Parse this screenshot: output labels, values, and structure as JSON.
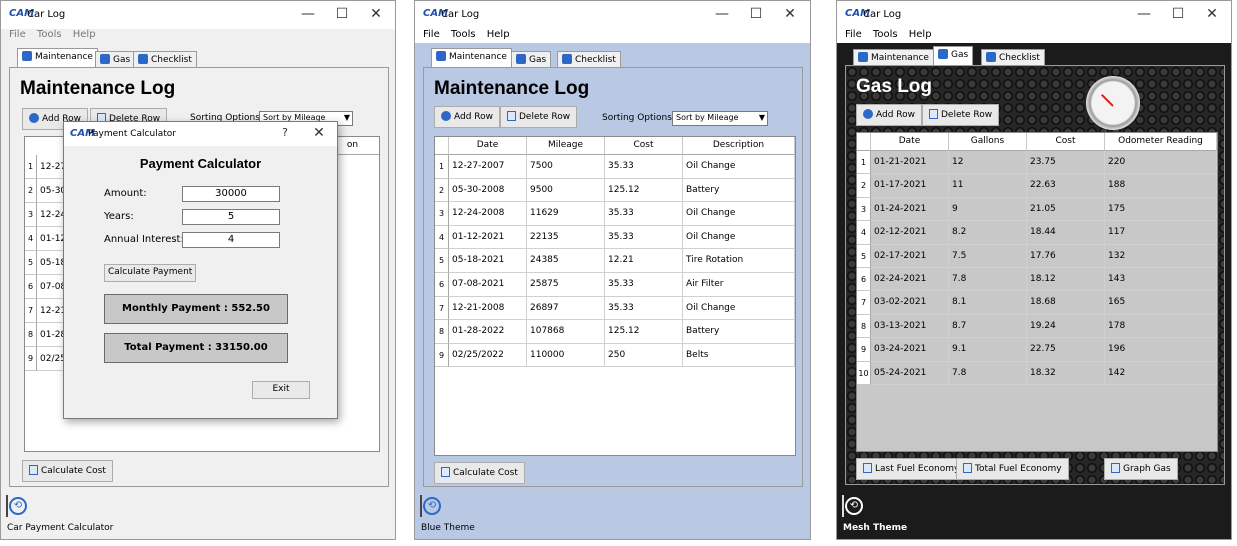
{
  "colors": {
    "accent": "#2d67c7",
    "blue_theme_bg": "#b9c9e3",
    "mesh_bg": "#1b1b1b"
  },
  "window_controls": {
    "minimize": "—",
    "maximize": "☐",
    "close": "✕"
  },
  "icons": {
    "logo": "CAM",
    "run_icon": "⟲"
  },
  "common": {
    "app_title": "Car Log",
    "menu": [
      "File",
      "Tools",
      "Help"
    ],
    "tabs": [
      "Maintenance",
      "Gas",
      "Checklist"
    ]
  },
  "maintenance": {
    "title": "Maintenance Log",
    "add_row": "Add Row",
    "delete_row": "Delete Row",
    "sort_label": "Sorting Options:",
    "sort_value": "Sort by Mileage",
    "calc_button": "Calculate Cost",
    "columns": [
      "Date",
      "Mileage",
      "Cost",
      "Description"
    ],
    "rows": [
      [
        "1",
        "12-27-2007",
        "7500",
        "35.33",
        "Oil Change"
      ],
      [
        "2",
        "05-30-2008",
        "9500",
        "125.12",
        "Battery"
      ],
      [
        "3",
        "12-24-2008",
        "11629",
        "35.33",
        "Oil Change"
      ],
      [
        "4",
        "01-12-2021",
        "22135",
        "35.33",
        "Oil Change"
      ],
      [
        "5",
        "05-18-2021",
        "24385",
        "12.21",
        "Tire Rotation"
      ],
      [
        "6",
        "07-08-2021",
        "25875",
        "35.33",
        "Air Filter"
      ],
      [
        "7",
        "12-21-2008",
        "26897",
        "35.33",
        "Oil Change"
      ],
      [
        "8",
        "01-28-2022",
        "107868",
        "125.12",
        "Battery"
      ],
      [
        "9",
        "02/25/2022",
        "110000",
        "250",
        "Belts"
      ]
    ]
  },
  "window1": {
    "status": "Car Payment Calculator",
    "partial_rows": [
      "12-27",
      "05-30-",
      "12-24-",
      "01-12-",
      "05-18-",
      "07-08-",
      "12-21-",
      "01-28-",
      "02/25/"
    ],
    "partial_header": "on",
    "dialog": {
      "title": "Payment Calculator",
      "help": "?",
      "close": "✕",
      "heading": "Payment Calculator",
      "amount_label": "Amount:",
      "amount": "30000",
      "years_label": "Years:",
      "years": "5",
      "interest_label": "Annual Interest:",
      "interest": "4",
      "calc_button": "Calculate Payment",
      "monthly": "Monthly Payment : 552.50",
      "total": "Total Payment : 33150.00",
      "exit": "Exit"
    }
  },
  "window2": {
    "status": "Blue Theme"
  },
  "window3": {
    "status": "Mesh Theme",
    "title": "Gas Log",
    "columns": [
      "Date",
      "Gallons",
      "Cost",
      "Odometer Reading"
    ],
    "rows": [
      [
        "1",
        "01-21-2021",
        "12",
        "23.75",
        "220"
      ],
      [
        "2",
        "01-17-2021",
        "11",
        "22.63",
        "188"
      ],
      [
        "3",
        "01-24-2021",
        "9",
        "21.05",
        "175"
      ],
      [
        "4",
        "02-12-2021",
        "8.2",
        "18.44",
        "117"
      ],
      [
        "5",
        "02-17-2021",
        "7.5",
        "17.76",
        "132"
      ],
      [
        "6",
        "02-24-2021",
        "7.8",
        "18.12",
        "143"
      ],
      [
        "7",
        "03-02-2021",
        "8.1",
        "18.68",
        "165"
      ],
      [
        "8",
        "03-13-2021",
        "8.7",
        "19.24",
        "178"
      ],
      [
        "9",
        "03-24-2021",
        "9.1",
        "22.75",
        "196"
      ],
      [
        "10",
        "05-24-2021",
        "7.8",
        "18.32",
        "142"
      ]
    ],
    "last_fuel": "Last Fuel Economy",
    "total_fuel": "Total Fuel Economy",
    "graph_gas": "Graph Gas"
  }
}
